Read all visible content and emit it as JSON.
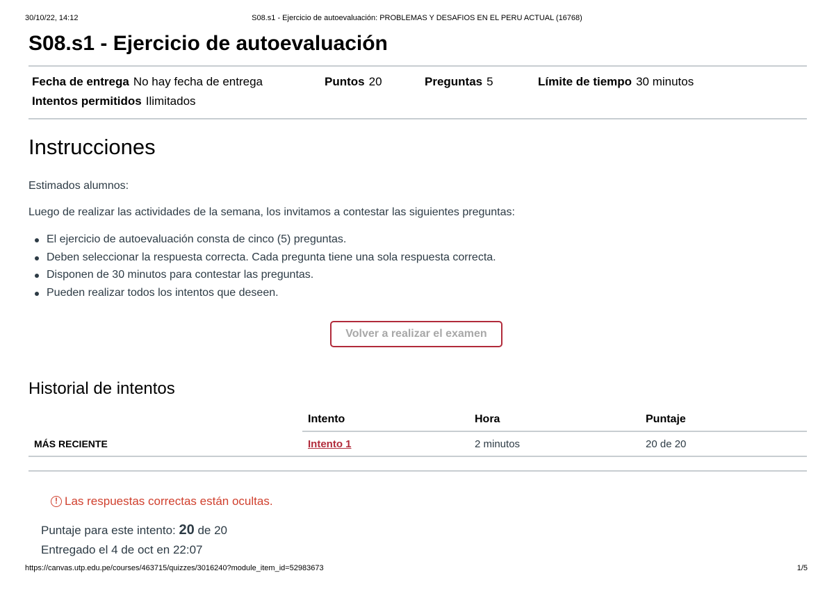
{
  "print": {
    "datetime": "30/10/22, 14:12",
    "doc_title": "S08.s1 - Ejercicio de autoevaluación: PROBLEMAS Y DESAFIOS EN EL PERU ACTUAL (16768)",
    "url": "https://canvas.utp.edu.pe/courses/463715/quizzes/3016240?module_item_id=52983673",
    "pages": "1/5"
  },
  "quiz": {
    "title": "S08.s1 - Ejercicio de autoevaluación",
    "details": {
      "due_label": "Fecha de entrega",
      "due_value": "No hay fecha de entrega",
      "points_label": "Puntos",
      "points_value": "20",
      "questions_label": "Preguntas",
      "questions_value": "5",
      "time_label": "Límite de tiempo",
      "time_value": "30 minutos",
      "attempts_label": "Intentos permitidos",
      "attempts_value": "Ilimitados"
    }
  },
  "instructions": {
    "heading": "Instrucciones",
    "greeting": "Estimados alumnos:",
    "intro": "Luego de realizar las actividades de la semana, los invitamos a contestar las siguientes preguntas:",
    "bullets": [
      "El ejercicio de autoevaluación consta de cinco (5) preguntas.",
      "Deben seleccionar la respuesta correcta. Cada pregunta tiene una sola respuesta correcta.",
      "Disponen de 30 minutos para contestar las preguntas.",
      "Pueden realizar todos los intentos que deseen."
    ]
  },
  "retake_button": "Volver a realizar el examen",
  "history": {
    "heading": "Historial de intentos",
    "columns": [
      "",
      "Intento",
      "Hora",
      "Puntaje"
    ],
    "rows": [
      {
        "label": "MÁS RECIENTE",
        "attempt": "Intento 1",
        "time": "2 minutos",
        "score": "20 de 20"
      }
    ]
  },
  "result": {
    "warning": "Las respuestas correctas están ocultas.",
    "warning_icon": "exclamation-circle-icon",
    "score_prefix": "Puntaje para este intento:",
    "score_value": "20",
    "score_suffix": "de 20",
    "submitted": "Entregado el 4 de oct en 22:07"
  },
  "colors": {
    "accent": "#b12a3a",
    "warning": "#d0402e",
    "rule": "#c7cdd1"
  }
}
